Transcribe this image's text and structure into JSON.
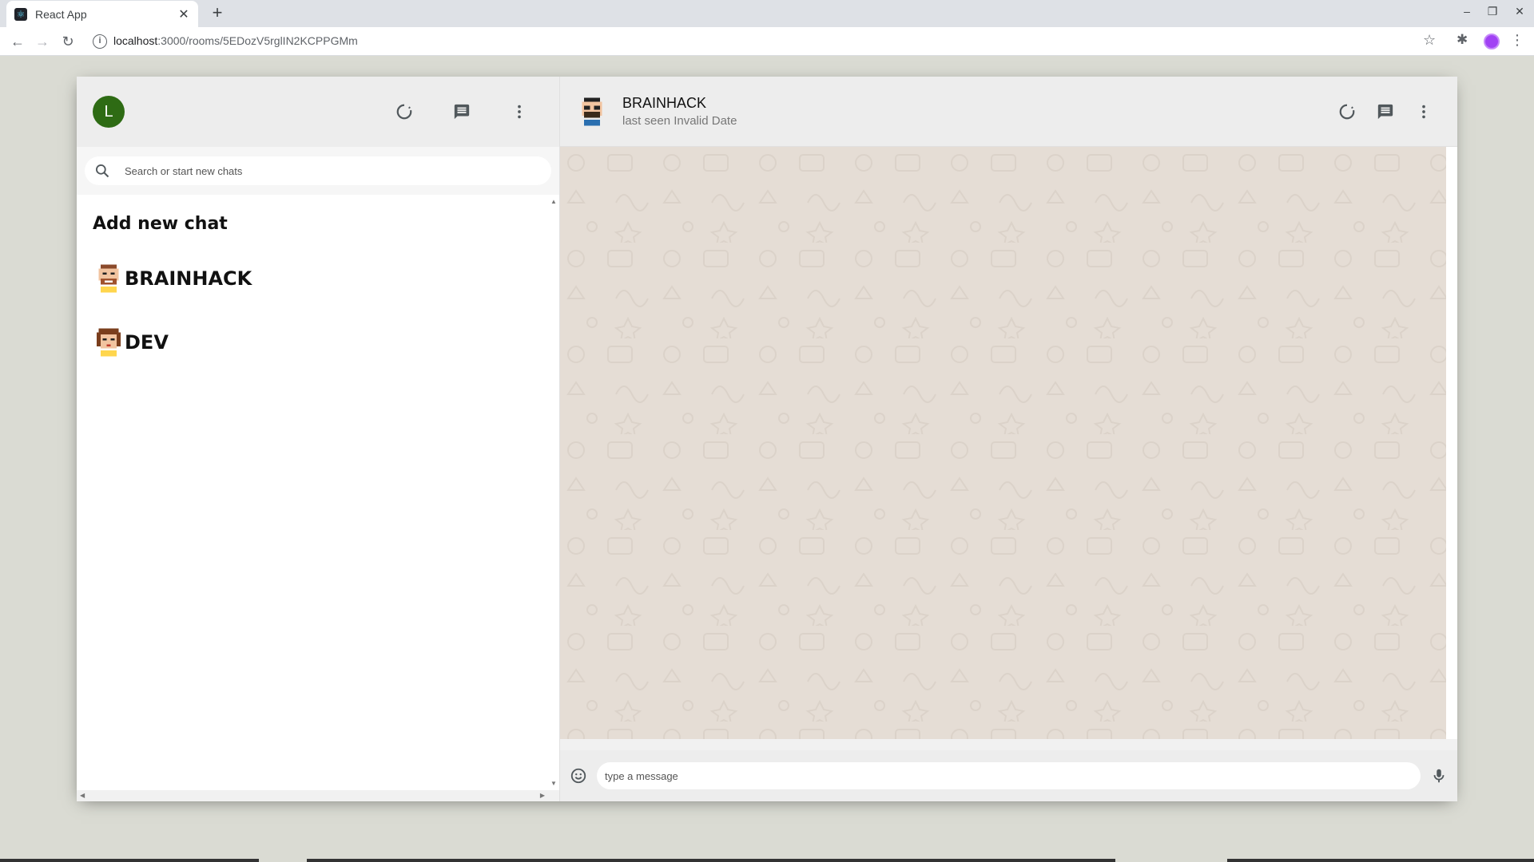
{
  "browser": {
    "tab_title": "React App",
    "url_host": "localhost",
    "url_path": ":3000/rooms/5EDozV5rglIN2KCPPGMm"
  },
  "sidebar": {
    "avatar_letter": "L",
    "search_placeholder": "Search or start new chats",
    "add_new_chat": "Add new chat",
    "rooms": [
      {
        "name": "BRAINHACK"
      },
      {
        "name": "DEV"
      }
    ]
  },
  "chat": {
    "title": "BRAINHACK",
    "subtitle": "last seen Invalid Date",
    "input_placeholder": "type a message"
  },
  "colors": {
    "avatar_bg": "#2e6b14",
    "chat_bg": "#e5ddd5",
    "app_bg": "#dadbd3"
  }
}
